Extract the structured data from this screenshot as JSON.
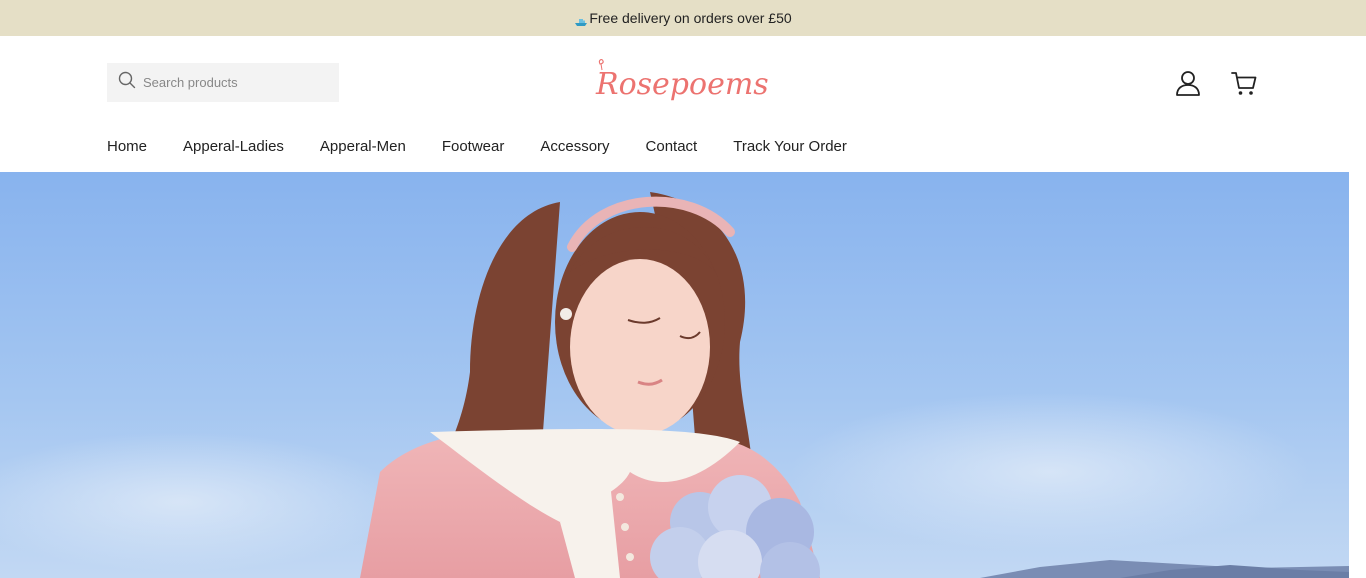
{
  "announcement": {
    "text": "Free delivery on orders over £50",
    "icon": "ship-icon"
  },
  "search": {
    "placeholder": "Search products",
    "value": "",
    "icon": "search-icon"
  },
  "logo": {
    "text": "Rosepoems",
    "color": "#ec7370"
  },
  "header_icons": {
    "account": "user-icon",
    "cart": "cart-icon"
  },
  "nav": {
    "items": [
      {
        "label": "Home"
      },
      {
        "label": "Apperal-Ladies"
      },
      {
        "label": "Apperal-Men"
      },
      {
        "label": "Footwear"
      },
      {
        "label": "Accessory"
      },
      {
        "label": "Contact"
      },
      {
        "label": "Track Your Order"
      }
    ]
  },
  "colors": {
    "announcement_bg": "#e5dfc6",
    "brand": "#ec7370",
    "text": "#222222"
  }
}
